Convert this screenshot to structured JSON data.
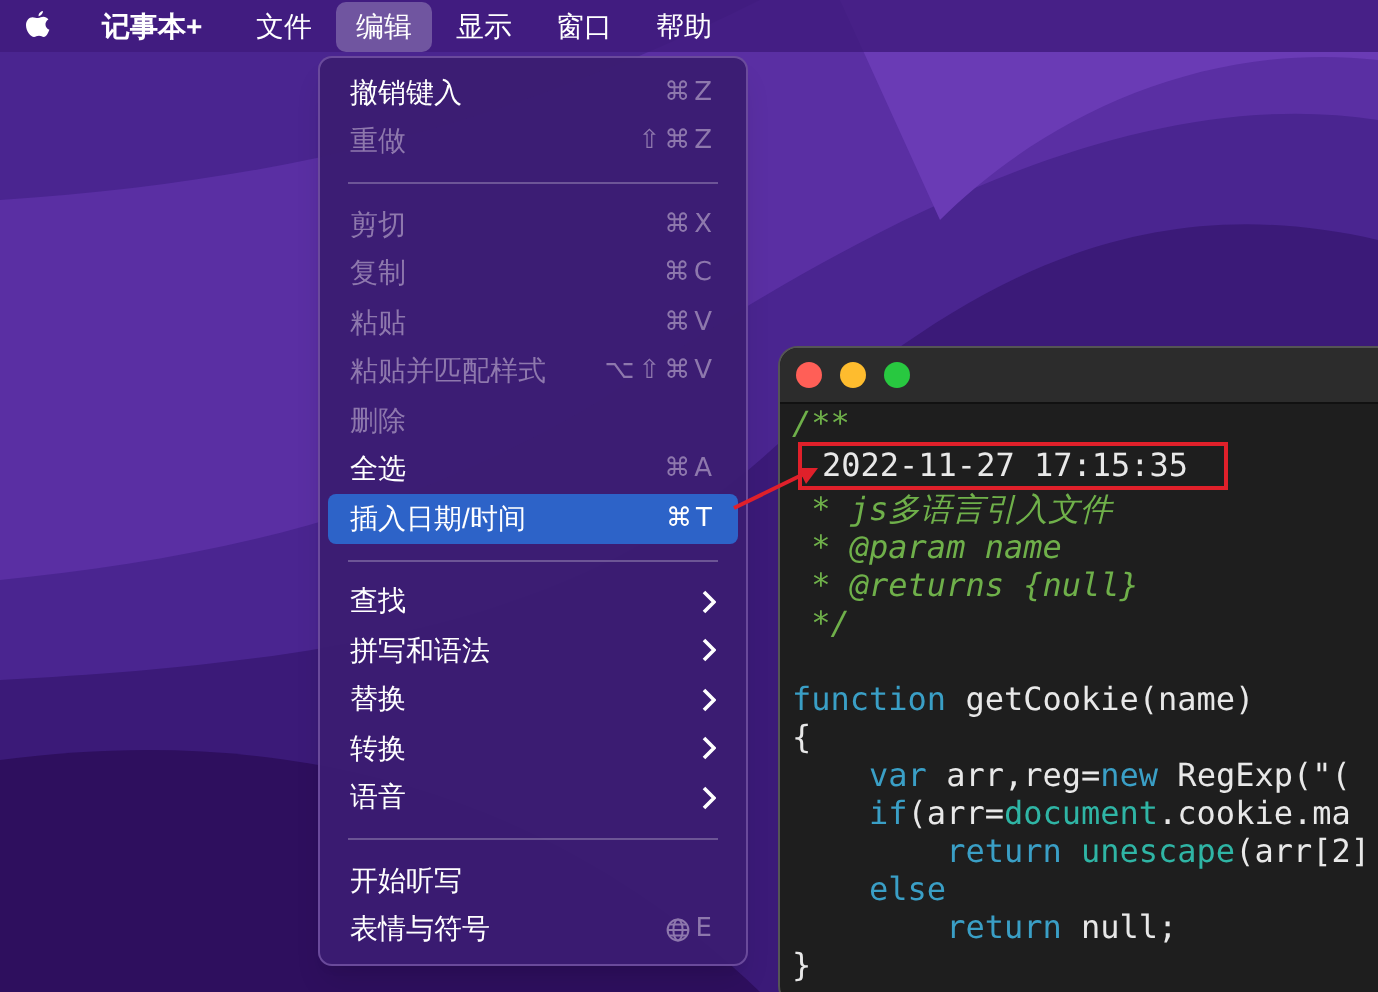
{
  "menu_bar": {
    "items": [
      {
        "label": "记事本+",
        "kind": "app",
        "selected": false
      },
      {
        "label": "文件",
        "kind": "menu",
        "selected": false
      },
      {
        "label": "编辑",
        "kind": "menu",
        "selected": true
      },
      {
        "label": "显示",
        "kind": "menu",
        "selected": false
      },
      {
        "label": "窗口",
        "kind": "menu",
        "selected": false
      },
      {
        "label": "帮助",
        "kind": "menu",
        "selected": false
      }
    ]
  },
  "edit_menu": {
    "items": [
      {
        "kind": "item",
        "label": "撤销键入",
        "shortcut": "⌘Z",
        "enabled": true,
        "selected": false
      },
      {
        "kind": "item",
        "label": "重做",
        "shortcut": "⇧⌘Z",
        "enabled": false,
        "selected": false
      },
      {
        "kind": "separator"
      },
      {
        "kind": "item",
        "label": "剪切",
        "shortcut": "⌘X",
        "enabled": false,
        "selected": false
      },
      {
        "kind": "item",
        "label": "复制",
        "shortcut": "⌘C",
        "enabled": false,
        "selected": false
      },
      {
        "kind": "item",
        "label": "粘贴",
        "shortcut": "⌘V",
        "enabled": false,
        "selected": false
      },
      {
        "kind": "item",
        "label": "粘贴并匹配样式",
        "shortcut": "⌥⇧⌘V",
        "enabled": false,
        "selected": false
      },
      {
        "kind": "item",
        "label": "删除",
        "enabled": false,
        "selected": false
      },
      {
        "kind": "item",
        "label": "全选",
        "shortcut": "⌘A",
        "enabled": true,
        "selected": false
      },
      {
        "kind": "item",
        "label": "插入日期/时间",
        "shortcut": "⌘T",
        "enabled": true,
        "selected": true
      },
      {
        "kind": "separator"
      },
      {
        "kind": "item",
        "label": "查找",
        "enabled": true,
        "selected": false,
        "submenu": true
      },
      {
        "kind": "item",
        "label": "拼写和语法",
        "enabled": true,
        "selected": false,
        "submenu": true
      },
      {
        "kind": "item",
        "label": "替换",
        "enabled": true,
        "selected": false,
        "submenu": true
      },
      {
        "kind": "item",
        "label": "转换",
        "enabled": true,
        "selected": false,
        "submenu": true
      },
      {
        "kind": "item",
        "label": "语音",
        "enabled": true,
        "selected": false,
        "submenu": true
      },
      {
        "kind": "separator"
      },
      {
        "kind": "item",
        "label": "开始听写",
        "enabled": true,
        "selected": false
      },
      {
        "kind": "item",
        "label": "表情与符号",
        "shortcut": "E",
        "globe": true,
        "enabled": true,
        "selected": false
      }
    ]
  },
  "editor": {
    "lines": [
      {
        "kind": "code",
        "tokens": [
          {
            "text": "/**",
            "kind": "comment"
          }
        ]
      },
      {
        "kind": "highlight",
        "tokens": [
          {
            "text": "2022-11-27 17:15:35",
            "kind": "plain"
          }
        ]
      },
      {
        "kind": "code",
        "tokens": [
          {
            "text": " * js多语言引入文件",
            "kind": "comment"
          }
        ]
      },
      {
        "kind": "code",
        "tokens": [
          {
            "text": " * @param name",
            "kind": "comment"
          }
        ]
      },
      {
        "kind": "code",
        "tokens": [
          {
            "text": " * @returns {null}",
            "kind": "comment"
          }
        ]
      },
      {
        "kind": "code",
        "tokens": [
          {
            "text": " */",
            "kind": "comment"
          }
        ]
      },
      {
        "kind": "blank"
      },
      {
        "kind": "code",
        "tokens": [
          {
            "text": "function",
            "kind": "keyword"
          },
          {
            "text": " getCookie(name)",
            "kind": "plain"
          }
        ]
      },
      {
        "kind": "code",
        "tokens": [
          {
            "text": "{",
            "kind": "plain"
          }
        ]
      },
      {
        "kind": "code",
        "tokens": [
          {
            "text": "    var",
            "kind": "keyword"
          },
          {
            "text": " arr,reg=",
            "kind": "plain"
          },
          {
            "text": "new",
            "kind": "keyword"
          },
          {
            "text": " RegExp(\"(",
            "kind": "plain"
          }
        ]
      },
      {
        "kind": "code",
        "tokens": [
          {
            "text": "    if",
            "kind": "keyword"
          },
          {
            "text": "(arr=",
            "kind": "plain"
          },
          {
            "text": "document",
            "kind": "builtin"
          },
          {
            "text": ".cookie.ma",
            "kind": "plain"
          }
        ]
      },
      {
        "kind": "code",
        "tokens": [
          {
            "text": "        return",
            "kind": "keyword"
          },
          {
            "text": " unescape",
            "kind": "builtin"
          },
          {
            "text": "(arr[2]",
            "kind": "plain"
          }
        ]
      },
      {
        "kind": "code",
        "tokens": [
          {
            "text": "    else",
            "kind": "keyword"
          }
        ]
      },
      {
        "kind": "code",
        "tokens": [
          {
            "text": "        return",
            "kind": "keyword"
          },
          {
            "text": " null;",
            "kind": "plain"
          }
        ]
      },
      {
        "kind": "code",
        "tokens": [
          {
            "text": "}",
            "kind": "plain"
          }
        ]
      }
    ]
  }
}
